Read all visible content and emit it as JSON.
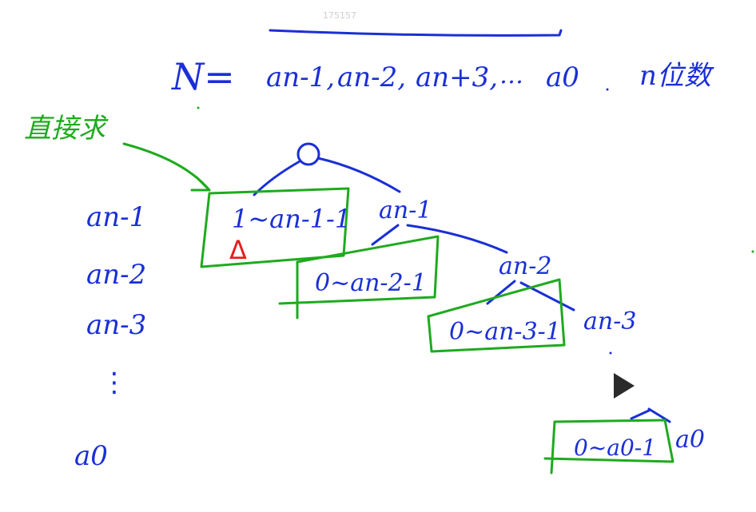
{
  "watermark": "175157",
  "equation": {
    "lhs": "N=",
    "digits": [
      "an-1,",
      "an-2,",
      "an+3,",
      "…",
      "a0"
    ],
    "suffix": "n位数"
  },
  "green_note": "直接求",
  "row_labels": [
    "an-1",
    "an-2",
    "an-3",
    "⋮",
    "a0"
  ],
  "tree": {
    "nodes": [
      "an-1",
      "an-2",
      "an-3",
      "a0"
    ],
    "boxes": [
      "1~an-1-1",
      "0~an-2-1",
      "0~an-3-1",
      "0~a0-1"
    ]
  },
  "red_mark": "Δ",
  "colors": {
    "ink_blue": "#1a2fd6",
    "ink_green": "#1faa1f",
    "ink_red": "#e81c1c"
  },
  "icons": {
    "play": "play-icon"
  }
}
